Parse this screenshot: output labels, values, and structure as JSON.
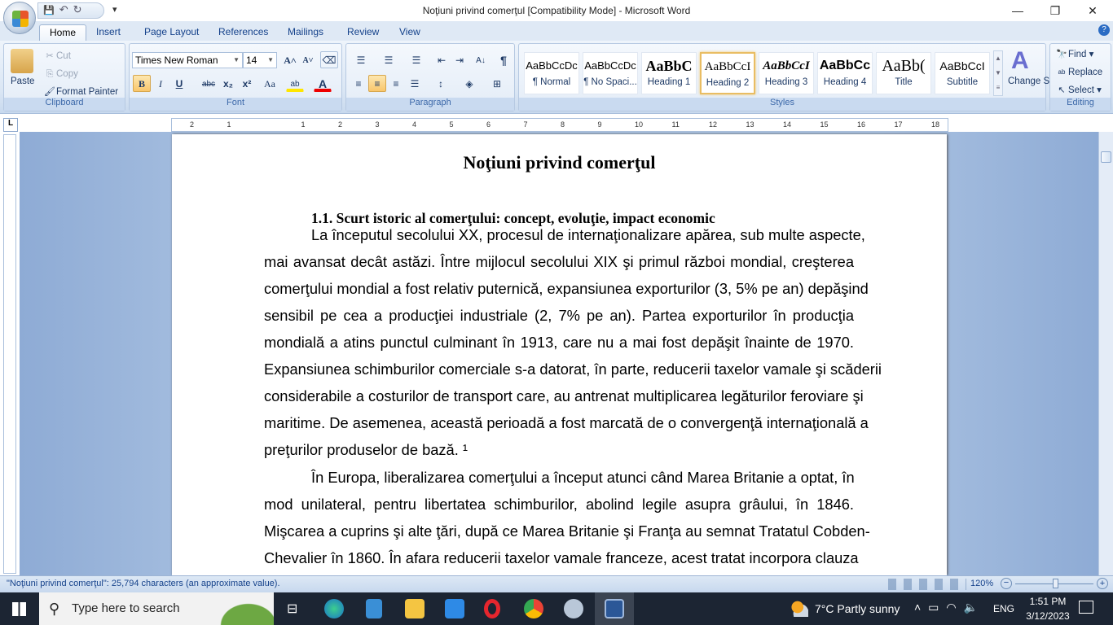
{
  "window": {
    "title": "Noţiuni privind comerţul [Compatibility Mode] - Microsoft Word",
    "minimize": "—",
    "restore": "❐",
    "close": "✕"
  },
  "qat": {
    "save": "💾",
    "undo": "↶",
    "redo": "↻",
    "more": "▾"
  },
  "tabs": [
    "Home",
    "Insert",
    "Page Layout",
    "References",
    "Mailings",
    "Review",
    "View"
  ],
  "clipboard": {
    "paste": "Paste",
    "cut": "Cut",
    "copy": "Copy",
    "format_painter": "Format Painter",
    "label": "Clipboard"
  },
  "font": {
    "name": "Times New Roman",
    "size": "14",
    "label": "Font",
    "bold": "B",
    "italic": "I",
    "underline": "U",
    "strike": "abc",
    "sub": "x₂",
    "sup": "x²",
    "case": "Aa",
    "grow": "A˄",
    "shrink": "A˅",
    "highlight": "ab",
    "color": "A"
  },
  "paragraph": {
    "label": "Paragraph",
    "pilcrow": "¶",
    "sort": "A↓"
  },
  "styles": {
    "label": "Styles",
    "items": [
      {
        "preview": "AaBbCcDc",
        "name": "¶ Normal"
      },
      {
        "preview": "AaBbCcDc",
        "name": "¶ No Spaci..."
      },
      {
        "preview": "AaBbC",
        "name": "Heading 1"
      },
      {
        "preview": "AaBbCcI",
        "name": "Heading 2"
      },
      {
        "preview": "AaBbCcI",
        "name": "Heading 3"
      },
      {
        "preview": "AaBbCc",
        "name": "Heading 4"
      },
      {
        "preview": "AaBb(",
        "name": "Title"
      },
      {
        "preview": "AaBbCcI",
        "name": "Subtitle"
      }
    ],
    "change_styles": "Change Styles"
  },
  "editing": {
    "label": "Editing",
    "find": "Find",
    "replace": "Replace",
    "select": "Select"
  },
  "ruler": {
    "ticks": [
      "2",
      "1",
      "",
      "1",
      "2",
      "3",
      "4",
      "5",
      "6",
      "7",
      "8",
      "9",
      "10",
      "11",
      "12",
      "13",
      "14",
      "15",
      "16",
      "17",
      "18"
    ]
  },
  "document": {
    "title": "Noţiuni privind comerţul",
    "heading": "1.1. Scurt istoric al comerţului: concept, evoluţie, impact economic",
    "lines": [
      "La începutul secolului XX, procesul de internaţionalizare apărea, sub multe aspecte,",
      "mai avansat decât astăzi. Între mijlocul secolului XIX şi primul război mondial, creşterea",
      "comerţului mondial a fost relativ puternică, expansiunea exporturilor (3, 5% pe an) depăşind",
      "sensibil pe cea a producţiei industriale (2, 7% pe an). Partea exporturilor în producţia",
      "mondială a atins punctul culminant în 1913, care nu a mai fost depăşit înainte de 1970.",
      "Expansiunea schimburilor comerciale s-a datorat, în parte, reducerii taxelor vamale şi scăderii",
      "considerabile a costurilor de transport care, au antrenat multiplicarea legăturilor feroviare şi",
      "maritime. De asemenea, această perioadă a fost marcată de o convergenţă internaţională a",
      "preţurilor produselor de bază. ¹",
      "În Europa, liberalizarea comerţului a început atunci când Marea Britanie a optat, în",
      "mod unilateral, pentru libertatea schimburilor, abolind legile asupra grâului, în 1846.",
      "Mişcarea a cuprins şi alte ţări, după ce Marea Britanie şi Franţa au semnat Tratatul Cobden-",
      "Chevalier în 1860. În afara reducerii taxelor vamale franceze, acest tratat incorpora clauza"
    ]
  },
  "status": {
    "text": "\"Noţiuni privind comerţul\": 25,794 characters (an approximate value).",
    "zoom": "120%"
  },
  "taskbar": {
    "search_placeholder": "Type here to search",
    "weather": "7°C  Partly sunny",
    "lang": "ENG",
    "time": "1:51 PM",
    "date": "3/12/2023"
  }
}
